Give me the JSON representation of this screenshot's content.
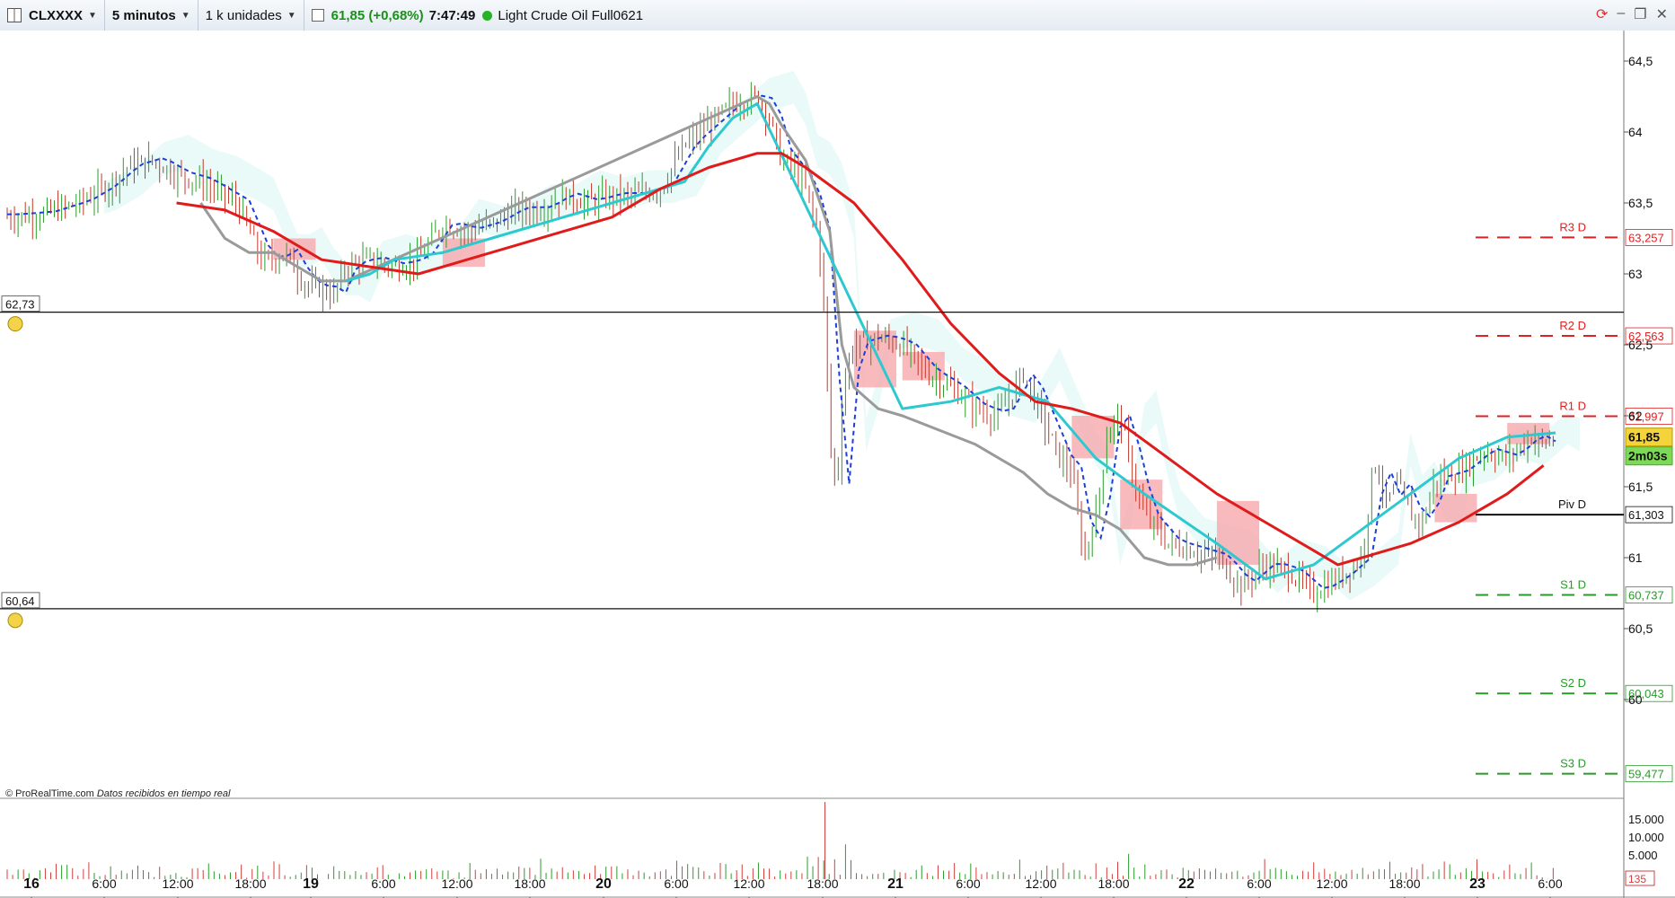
{
  "toolbar": {
    "symbol": "CLXXXX",
    "timeframe": "5 minutos",
    "units": "1 k unidades",
    "last_price_change": "61,85 (+0,68%)",
    "time": "7:47:49",
    "instrument_name": "Light Crude Oil Full0621",
    "live_color": "#27b227"
  },
  "window_buttons": [
    "refresh-icon",
    "minimize-icon",
    "restore-icon",
    "close-icon"
  ],
  "footer": {
    "copyright": "© ProRealTime.com",
    "realtime_note": "Datos recibidos en tiempo real"
  },
  "chart_data": {
    "type": "candlestick",
    "ylim": [
      60.0,
      64.6
    ],
    "yticks": [
      "64,5",
      "64",
      "63,5",
      "63",
      "62,5",
      "62",
      "61,5",
      "61",
      "60,5",
      "60"
    ],
    "x_labels": [
      "16",
      "6:00",
      "12:00",
      "18:00",
      "19",
      "6:00",
      "12:00",
      "18:00",
      "20",
      "6:00",
      "12:00",
      "18:00",
      "21",
      "6:00",
      "12:00",
      "18:00",
      "22",
      "6:00",
      "12:00",
      "18:00",
      "23",
      "6:00"
    ],
    "x_bold": [
      "16",
      "19",
      "20",
      "21",
      "22",
      "23"
    ],
    "current_price": {
      "value": 61.85,
      "label": "61,85",
      "countdown": "2m03s"
    },
    "horizontal_lines": [
      {
        "value": 62.73,
        "label": "62,73"
      },
      {
        "value": 60.64,
        "label": "60,64"
      }
    ],
    "pivots": [
      {
        "name": "R3 D",
        "value": 63.257,
        "label": "63,257",
        "color": "#e02020"
      },
      {
        "name": "R2 D",
        "value": 62.563,
        "label": "62,563",
        "color": "#e02020"
      },
      {
        "name": "R1 D",
        "value": 61.997,
        "label": "61,997",
        "color": "#e02020"
      },
      {
        "name": "Piv D",
        "value": 61.303,
        "label": "61,303",
        "color": "#111111"
      },
      {
        "name": "S1 D",
        "value": 60.737,
        "label": "60,737",
        "color": "#2a9a2a"
      },
      {
        "name": "S2 D",
        "value": 60.043,
        "label": "60,043",
        "color": "#2a9a2a"
      },
      {
        "name": "S3 D",
        "value": 59.477,
        "label": "59,477",
        "color": "#2a9a2a"
      }
    ],
    "price_path": [
      [
        0,
        63.4
      ],
      [
        3,
        63.42
      ],
      [
        6,
        63.5
      ],
      [
        8,
        63.6
      ],
      [
        10,
        63.75
      ],
      [
        12,
        63.8
      ],
      [
        14,
        63.7
      ],
      [
        16,
        63.65
      ],
      [
        18,
        63.55
      ],
      [
        19,
        63.5
      ],
      [
        20,
        63.3
      ],
      [
        21,
        63.1
      ],
      [
        22,
        63.1
      ],
      [
        23,
        63.15
      ],
      [
        24,
        63.0
      ],
      [
        25,
        62.9
      ],
      [
        26,
        62.9
      ],
      [
        27,
        62.85
      ],
      [
        28,
        63.05
      ],
      [
        30,
        63.1
      ],
      [
        32,
        63.05
      ],
      [
        34,
        63.1
      ],
      [
        36,
        63.35
      ],
      [
        38,
        63.3
      ],
      [
        40,
        63.35
      ],
      [
        42,
        63.45
      ],
      [
        44,
        63.45
      ],
      [
        46,
        63.55
      ],
      [
        48,
        63.5
      ],
      [
        50,
        63.55
      ],
      [
        52,
        63.55
      ],
      [
        54,
        63.6
      ],
      [
        56,
        63.9
      ],
      [
        58,
        64.05
      ],
      [
        60,
        64.2
      ],
      [
        62,
        64.25
      ],
      [
        63,
        64.1
      ],
      [
        64,
        63.8
      ],
      [
        65,
        63.75
      ],
      [
        66,
        63.6
      ],
      [
        67,
        63.3
      ],
      [
        67.6,
        62.7
      ],
      [
        68,
        61.8
      ],
      [
        68.6,
        61.5
      ],
      [
        69,
        62.1
      ],
      [
        69.6,
        62.4
      ],
      [
        70,
        62.5
      ],
      [
        72,
        62.55
      ],
      [
        74,
        62.5
      ],
      [
        76,
        62.3
      ],
      [
        78,
        62.2
      ],
      [
        80,
        62.05
      ],
      [
        82,
        62.0
      ],
      [
        84,
        62.3
      ],
      [
        85,
        62.1
      ],
      [
        86,
        61.9
      ],
      [
        87,
        61.7
      ],
      [
        88,
        61.6
      ],
      [
        89,
        61.0
      ],
      [
        90,
        61.3
      ],
      [
        91,
        61.9
      ],
      [
        92,
        62.0
      ],
      [
        93,
        61.6
      ],
      [
        94,
        61.3
      ],
      [
        95,
        61.2
      ],
      [
        96,
        61.1
      ],
      [
        98,
        61.05
      ],
      [
        100,
        61.0
      ],
      [
        102,
        60.8
      ],
      [
        104,
        60.95
      ],
      [
        106,
        60.9
      ],
      [
        108,
        60.75
      ],
      [
        110,
        60.85
      ],
      [
        112,
        61.0
      ],
      [
        113,
        61.7
      ],
      [
        114,
        61.4
      ],
      [
        115,
        61.5
      ],
      [
        116,
        61.3
      ],
      [
        117,
        61.25
      ],
      [
        118,
        61.55
      ],
      [
        120,
        61.6
      ],
      [
        122,
        61.75
      ],
      [
        124,
        61.7
      ],
      [
        126,
        61.85
      ],
      [
        127,
        61.8
      ],
      [
        128,
        61.85
      ]
    ],
    "ema_red": [
      [
        14,
        63.5
      ],
      [
        18,
        63.45
      ],
      [
        22,
        63.3
      ],
      [
        26,
        63.1
      ],
      [
        30,
        63.05
      ],
      [
        34,
        63.0
      ],
      [
        38,
        63.1
      ],
      [
        42,
        63.2
      ],
      [
        46,
        63.3
      ],
      [
        50,
        63.4
      ],
      [
        54,
        63.6
      ],
      [
        58,
        63.75
      ],
      [
        62,
        63.85
      ],
      [
        64,
        63.85
      ],
      [
        66,
        63.75
      ],
      [
        70,
        63.5
      ],
      [
        74,
        63.1
      ],
      [
        78,
        62.65
      ],
      [
        82,
        62.3
      ],
      [
        85,
        62.1
      ],
      [
        88,
        62.05
      ],
      [
        92,
        61.95
      ],
      [
        96,
        61.7
      ],
      [
        100,
        61.45
      ],
      [
        104,
        61.25
      ],
      [
        108,
        61.05
      ],
      [
        110,
        60.95
      ],
      [
        112,
        61.0
      ],
      [
        116,
        61.1
      ],
      [
        120,
        61.25
      ],
      [
        124,
        61.45
      ],
      [
        127,
        61.65
      ]
    ],
    "ma_gray": [
      [
        16,
        63.5
      ],
      [
        18,
        63.25
      ],
      [
        20,
        63.15
      ],
      [
        22,
        63.15
      ],
      [
        24,
        63.05
      ],
      [
        26,
        62.95
      ],
      [
        28,
        62.95
      ],
      [
        62,
        64.25
      ],
      [
        63,
        64.2
      ],
      [
        64,
        64.05
      ],
      [
        66,
        63.8
      ],
      [
        68,
        63.3
      ],
      [
        69,
        62.5
      ],
      [
        70,
        62.2
      ],
      [
        72,
        62.05
      ],
      [
        74,
        62.0
      ],
      [
        80,
        61.8
      ],
      [
        84,
        61.6
      ],
      [
        86,
        61.45
      ],
      [
        88,
        61.35
      ],
      [
        90,
        61.3
      ],
      [
        92,
        61.2
      ],
      [
        94,
        61.0
      ],
      [
        96,
        60.95
      ],
      [
        98,
        60.95
      ],
      [
        100,
        61.0
      ]
    ],
    "ma_cyan": [
      [
        28,
        62.95
      ],
      [
        30,
        63.0
      ],
      [
        32,
        63.1
      ],
      [
        36,
        63.15
      ],
      [
        40,
        63.25
      ],
      [
        44,
        63.35
      ],
      [
        48,
        63.45
      ],
      [
        52,
        63.55
      ],
      [
        56,
        63.65
      ],
      [
        58,
        63.9
      ],
      [
        60,
        64.1
      ],
      [
        62,
        64.2
      ],
      [
        74,
        62.05
      ],
      [
        78,
        62.1
      ],
      [
        82,
        62.2
      ],
      [
        86,
        62.1
      ],
      [
        90,
        61.7
      ],
      [
        94,
        61.45
      ],
      [
        100,
        61.1
      ],
      [
        104,
        60.85
      ],
      [
        108,
        60.95
      ],
      [
        112,
        61.2
      ],
      [
        116,
        61.45
      ],
      [
        120,
        61.7
      ],
      [
        124,
        61.85
      ],
      [
        128,
        61.88
      ]
    ]
  }
}
